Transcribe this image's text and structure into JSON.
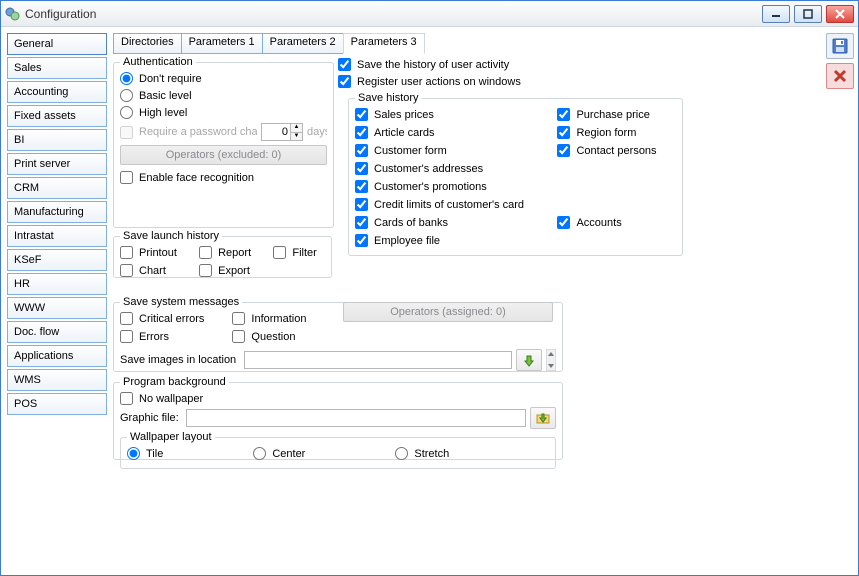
{
  "window": {
    "title": "Configuration"
  },
  "sidebar": {
    "items": [
      {
        "label": "General",
        "active": true
      },
      {
        "label": "Sales"
      },
      {
        "label": "Accounting"
      },
      {
        "label": "Fixed assets"
      },
      {
        "label": "BI"
      },
      {
        "label": "Print server"
      },
      {
        "label": "CRM"
      },
      {
        "label": "Manufacturing"
      },
      {
        "label": "Intrastat"
      },
      {
        "label": "KSeF"
      },
      {
        "label": "HR"
      },
      {
        "label": "WWW"
      },
      {
        "label": "Doc. flow"
      },
      {
        "label": "Applications"
      },
      {
        "label": "WMS"
      },
      {
        "label": "POS"
      }
    ]
  },
  "tabs": [
    {
      "label": "Directories"
    },
    {
      "label": "Parameters 1"
    },
    {
      "label": "Parameters 2"
    },
    {
      "label": "Parameters 3",
      "active": true
    }
  ],
  "auth": {
    "legend": "Authentication",
    "opts": [
      "Don't require",
      "Basic level",
      "High level"
    ],
    "selected": 0,
    "requirePwdLabel": "Require a password change",
    "pwdDays": "0",
    "daysSuffix": "days",
    "operatorsBtn": "Operators (excluded: 0)",
    "faceLabel": "Enable face recognition"
  },
  "toggles": {
    "saveHistory": "Save the history of user activity",
    "registerActions": "Register user actions on windows"
  },
  "saveHistory": {
    "legend": "Save history",
    "items": [
      [
        "Sales prices",
        "Purchase price"
      ],
      [
        "Article cards",
        "Region form"
      ],
      [
        "Customer form",
        "Contact persons"
      ],
      [
        "Customer's addresses",
        ""
      ],
      [
        "Customer's promotions",
        ""
      ],
      [
        "Credit limits of customer's card",
        ""
      ],
      [
        "Cards of banks",
        "Accounts"
      ],
      [
        "Employee file",
        ""
      ]
    ]
  },
  "launch": {
    "legend": "Save launch history",
    "items": [
      "Printout",
      "Report",
      "Filter",
      "Chart",
      "Export"
    ]
  },
  "sysmsg": {
    "legend": "Save system messages",
    "items": [
      "Critical errors",
      "Information",
      "Errors",
      "Question"
    ],
    "locationLabel": "Save images in location",
    "locationValue": ""
  },
  "ops2": "Operators (assigned: 0)",
  "bg": {
    "legend": "Program background",
    "noWall": "No wallpaper",
    "fileLabel": "Graphic file:",
    "fileValue": "",
    "layoutLegend": "Wallpaper layout",
    "opts": [
      "Tile",
      "Center",
      "Stretch"
    ],
    "selected": 0
  }
}
